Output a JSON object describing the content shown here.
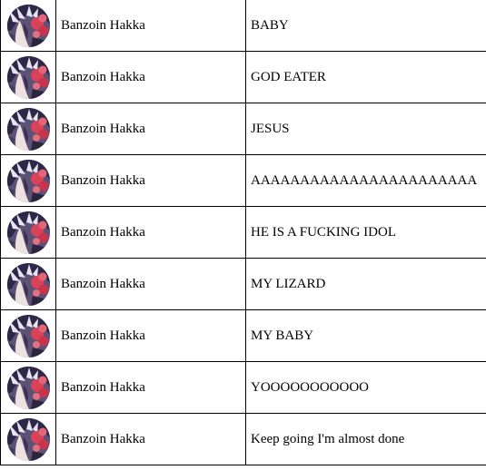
{
  "rows": [
    {
      "user": "Banzoin Hakka",
      "message": "BABY"
    },
    {
      "user": "Banzoin Hakka",
      "message": "GOD EATER"
    },
    {
      "user": "Banzoin Hakka",
      "message": "JESUS"
    },
    {
      "user": "Banzoin Hakka",
      "message": "AAAAAAAAAAAAAAAAAAAAAAA"
    },
    {
      "user": "Banzoin Hakka",
      "message": "HE IS A FUCKING IDOL"
    },
    {
      "user": "Banzoin Hakka",
      "message": "MY LIZARD"
    },
    {
      "user": "Banzoin Hakka",
      "message": "MY BABY"
    },
    {
      "user": "Banzoin Hakka",
      "message": "YOOOOOOOOOOO"
    },
    {
      "user": "Banzoin Hakka",
      "message": "Keep going I'm almost done"
    }
  ],
  "avatar_icon": "avatar-portrait-icon",
  "colors": {
    "border": "#000000",
    "background": "#ffffff",
    "text": "#000000",
    "avatar_hair": "#2e2848",
    "avatar_flower": "#d8435a"
  }
}
